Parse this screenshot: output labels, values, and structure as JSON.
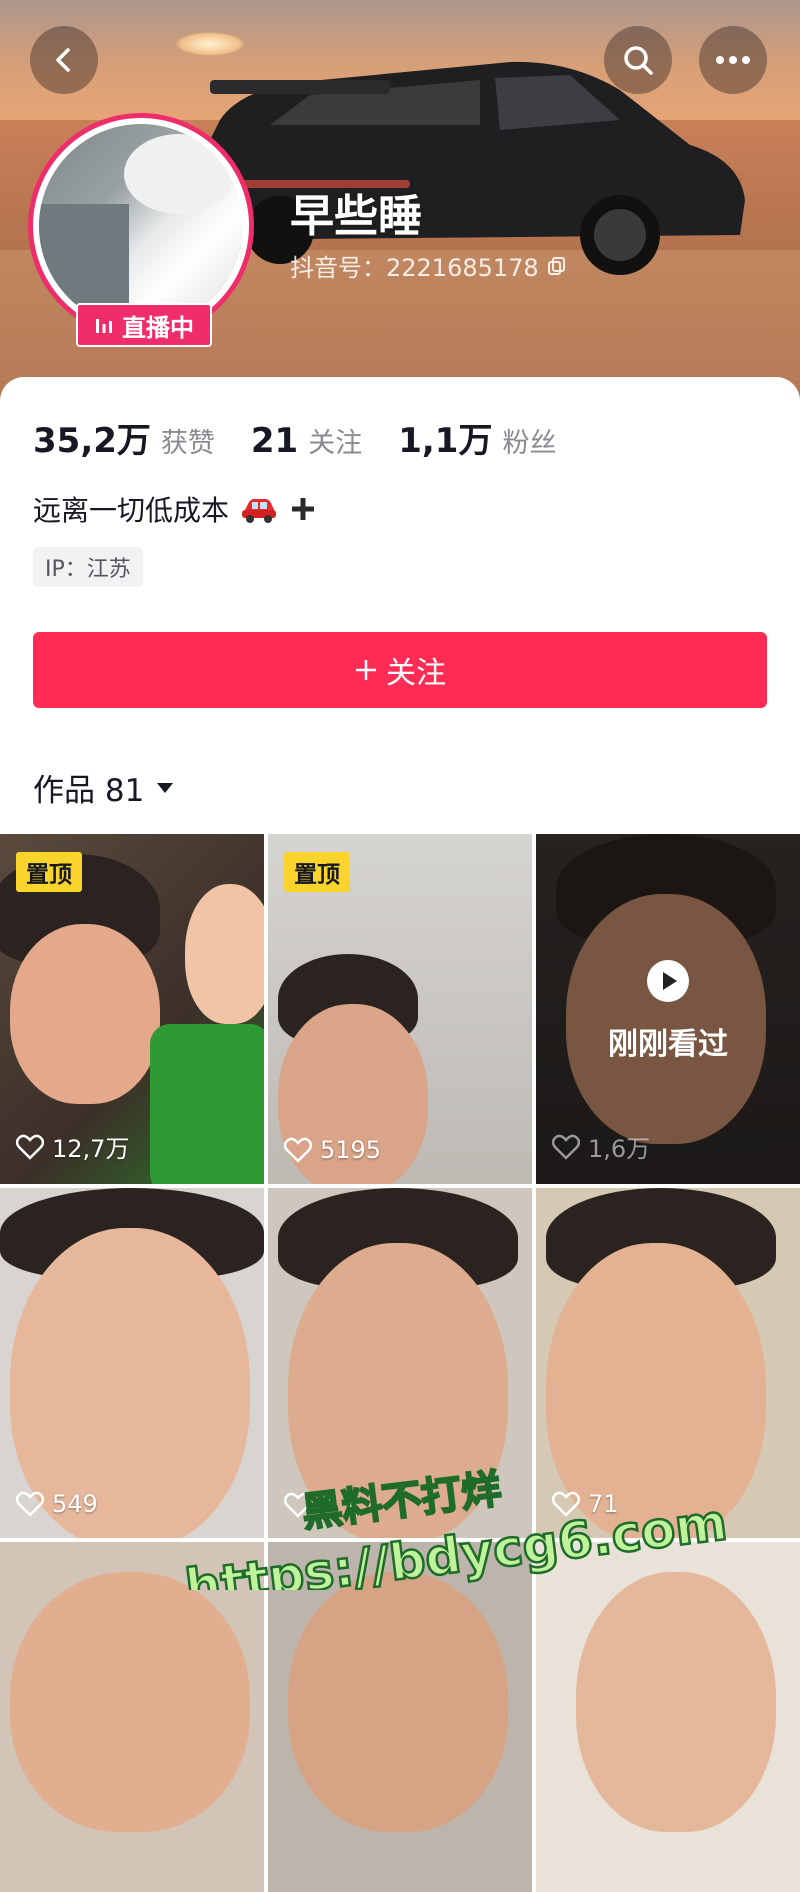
{
  "header": {
    "nickname": "早些睡",
    "douyin_id": "抖音号：2221685178",
    "live_label": "直播中"
  },
  "stats": [
    {
      "value": "35,2万",
      "label": "获赞"
    },
    {
      "value": "21",
      "label": "关注"
    },
    {
      "value": "1,1万",
      "label": "粉丝"
    }
  ],
  "bio": "远离一切低成本",
  "ip": "IP：江苏",
  "follow_label": "关注",
  "works_tab": "作品 81",
  "videos": [
    {
      "pinned": "置顶",
      "likes": "12,7万"
    },
    {
      "pinned": "置顶",
      "likes": "5195"
    },
    {
      "viewed": "刚刚看过",
      "likes": "1,6万"
    },
    {
      "likes": "549"
    },
    {
      "likes": ""
    },
    {
      "likes": "71"
    }
  ],
  "watermark": {
    "line1": "黑料不打烊",
    "line2": "https://bdycg6.com"
  },
  "colors": {
    "accent": "#fe2c55",
    "live": "#ef2d6a",
    "pin": "#f9d42d"
  }
}
